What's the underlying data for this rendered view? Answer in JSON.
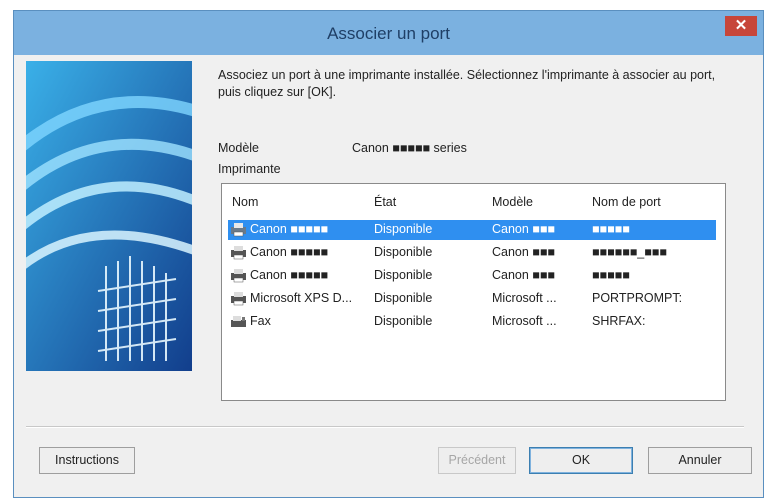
{
  "window": {
    "title": "Associer un port",
    "close_glyph": "✕"
  },
  "description": "Associez un port à une imprimante installée. Sélectionnez l'imprimante à associer au port, puis cliquez sur [OK].",
  "model": {
    "label": "Modèle",
    "value": "Canon ■■■■■ series"
  },
  "printer_label": "Imprimante",
  "columns": [
    "Nom",
    "État",
    "Modèle",
    "Nom de port"
  ],
  "printers": [
    {
      "name": "Canon ■■■■■",
      "state": "Disponible",
      "model": "Canon ■■■",
      "port": "■■■■■",
      "selected": true,
      "icon": "printer-icon"
    },
    {
      "name": "Canon ■■■■■",
      "state": "Disponible",
      "model": "Canon ■■■",
      "port": "■■■■■■_■■■",
      "selected": false,
      "icon": "printer-icon"
    },
    {
      "name": "Canon ■■■■■",
      "state": "Disponible",
      "model": "Canon ■■■",
      "port": "■■■■■",
      "selected": false,
      "icon": "printer-icon"
    },
    {
      "name": "Microsoft XPS D...",
      "state": "Disponible",
      "model": "Microsoft ...",
      "port": "PORTPROMPT:",
      "selected": false,
      "icon": "printer-icon"
    },
    {
      "name": "Fax",
      "state": "Disponible",
      "model": "Microsoft ...",
      "port": "SHRFAX:",
      "selected": false,
      "icon": "fax-icon"
    }
  ],
  "buttons": {
    "instructions": "Instructions",
    "disabled_label": "Précédent",
    "ok": "OK",
    "cancel": "Annuler"
  },
  "colors": {
    "titlebar": "#7bb1e0",
    "selection": "#2f8ff0",
    "art_background": "#1c5fb4"
  }
}
